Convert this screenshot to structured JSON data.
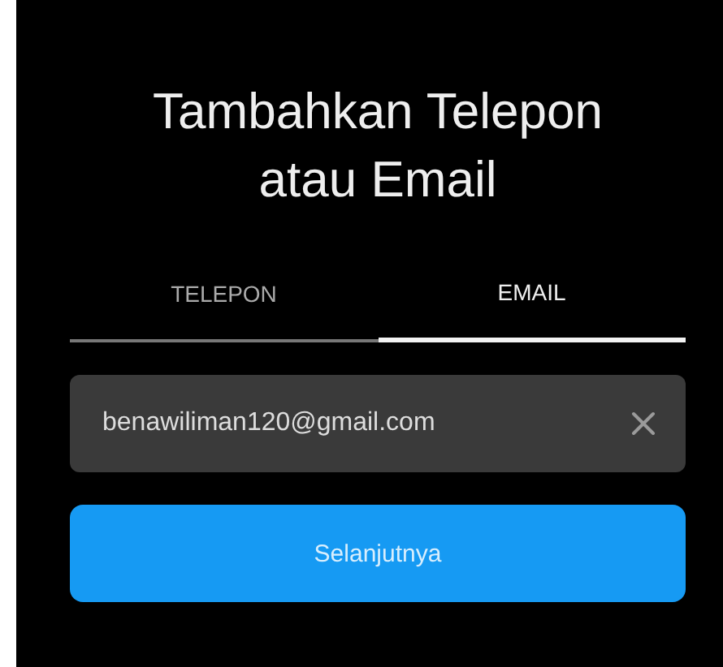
{
  "title": "Tambahkan Telepon atau Email",
  "tabs": [
    {
      "label": "TELEPON",
      "selected": false
    },
    {
      "label": "EMAIL",
      "selected": true
    }
  ],
  "email_field": {
    "value": "benawiliman120@gmail.com"
  },
  "next_button": {
    "label": "Selanjutnya"
  }
}
